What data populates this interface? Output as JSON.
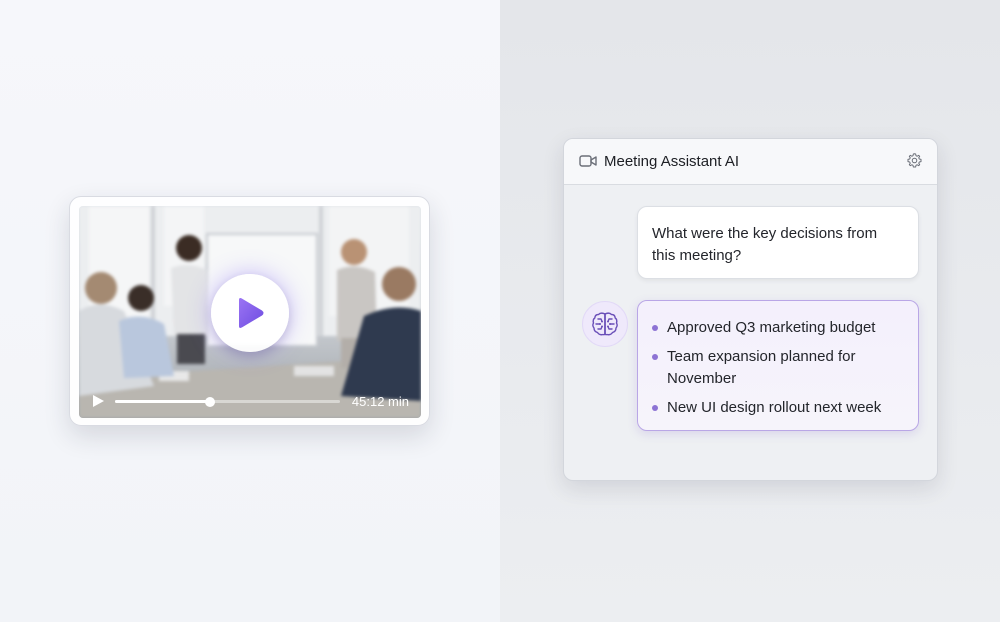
{
  "video": {
    "duration": "45:12 min",
    "progress": 0.42
  },
  "assistant": {
    "title": "Meeting Assistant AI",
    "header_icon": "video-camera-icon",
    "settings_icon": "gear-icon",
    "user_question": "What were the key decisions from this meeting?",
    "ai_avatar_icon": "brain-icon",
    "ai_answer_items": [
      "Approved Q3 marketing budget",
      "Team expansion planned for November",
      "New UI design rollout next week"
    ]
  },
  "colors": {
    "accent": "#8b5cf6",
    "accent_border": "#b9a6e6"
  }
}
